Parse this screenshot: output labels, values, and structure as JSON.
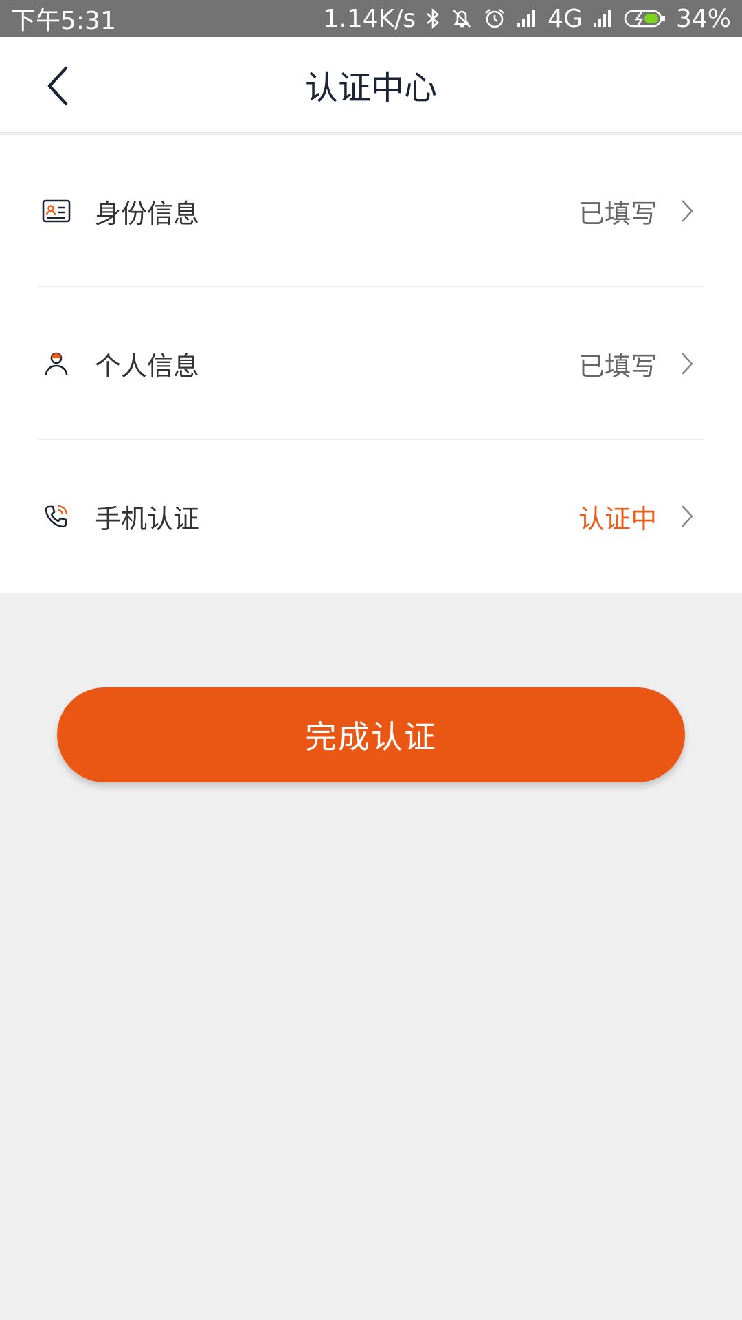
{
  "status_bar": {
    "time": "下午5:31",
    "net_speed": "1.14K/s",
    "network": "4G",
    "battery": "34%"
  },
  "header": {
    "title": "认证中心"
  },
  "items": [
    {
      "label": "身份信息",
      "status": "已填写",
      "icon": "id-card-icon"
    },
    {
      "label": "个人信息",
      "status": "已填写",
      "icon": "person-icon"
    },
    {
      "label": "手机认证",
      "status": "认证中",
      "icon": "phone-icon"
    }
  ],
  "actions": {
    "complete_label": "完成认证"
  },
  "colors": {
    "accent": "#ea5614",
    "status_bar": "#737373",
    "title": "#1b2435",
    "pending": "#e95e1c",
    "background": "#efefef"
  }
}
